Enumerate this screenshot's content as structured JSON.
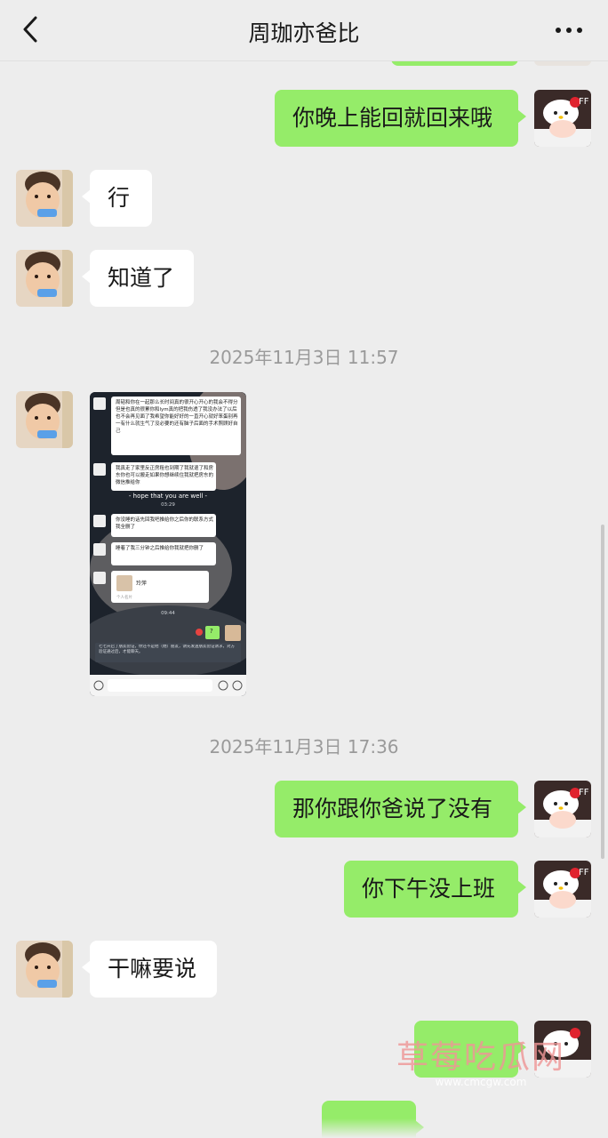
{
  "header": {
    "title": "周珈亦爸比",
    "back_icon": "chevron-left-icon",
    "more_icon": "more-dots-icon"
  },
  "messages": [
    {
      "side": "me",
      "text": "你晚上能回就回来哦"
    },
    {
      "side": "them",
      "text": "行"
    },
    {
      "side": "them",
      "text": "知道了"
    },
    {
      "time": "2025年11月3日 11:57"
    },
    {
      "side": "them",
      "type": "image",
      "image": {
        "lines": [
          "周韬和你在一起那么长时间真的很开心开心的我会不得分但是也真的很累你和lym真的把我伤透了我没办法了以后也不会再见面了我希望你能好好的一直开心就好笨蛋别再一有什么就生气了没必要的还有脑子后面的手术照顾好自己",
          "我真走了家里反正房租也到期了我就退了和房东你也可以搬走如果你想继续住我就把房东的微信推给你",
          "- hope that you are well -",
          "03:29",
          "你没睡的话先回我吧推给你之后你的联系方式我全删了",
          "睡着了我三分钟之后推给你我就把你删了",
          "玲萍",
          "个人名片",
          "09:44",
          "?",
          "七七开启了朋友验证，你还不是他（她）朋友，请先发送朋友验证请求，对方验证通过后，才能聊天。"
        ]
      }
    },
    {
      "time": "2025年11月3日 17:36"
    },
    {
      "side": "me",
      "text": "那你跟你爸说了没有"
    },
    {
      "side": "me",
      "text": "你下午没上班"
    },
    {
      "side": "them",
      "text": "干嘛要说"
    }
  ],
  "watermark": {
    "cn": "草莓吃瓜网",
    "url": "www.cmcgw.com"
  },
  "colors": {
    "my_bubble": "#95ec69",
    "their_bubble": "#ffffff",
    "background": "#ededed"
  }
}
